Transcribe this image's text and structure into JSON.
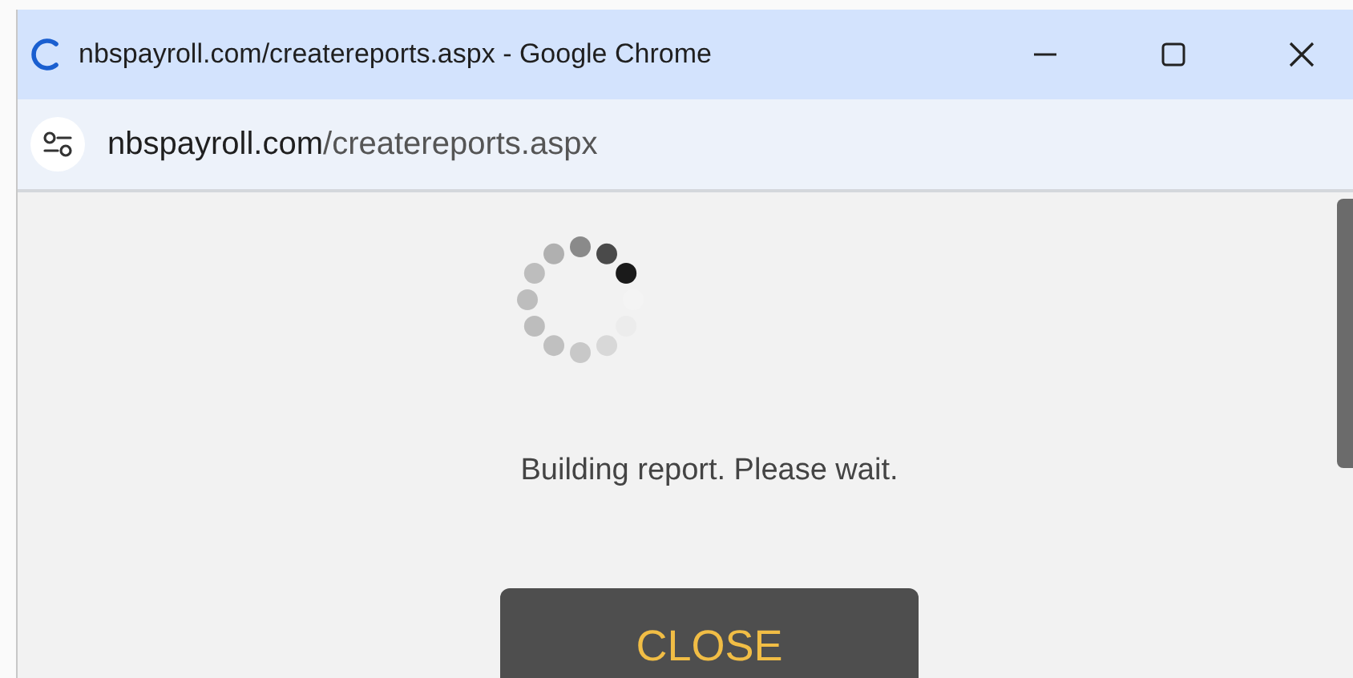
{
  "window": {
    "title": "nbspayroll.com/createreports.aspx - Google Chrome"
  },
  "address_bar": {
    "domain": "nbspayroll.com",
    "path": "/createreports.aspx"
  },
  "dialog": {
    "message": "Building report. Please wait.",
    "button": "CLOSE"
  }
}
